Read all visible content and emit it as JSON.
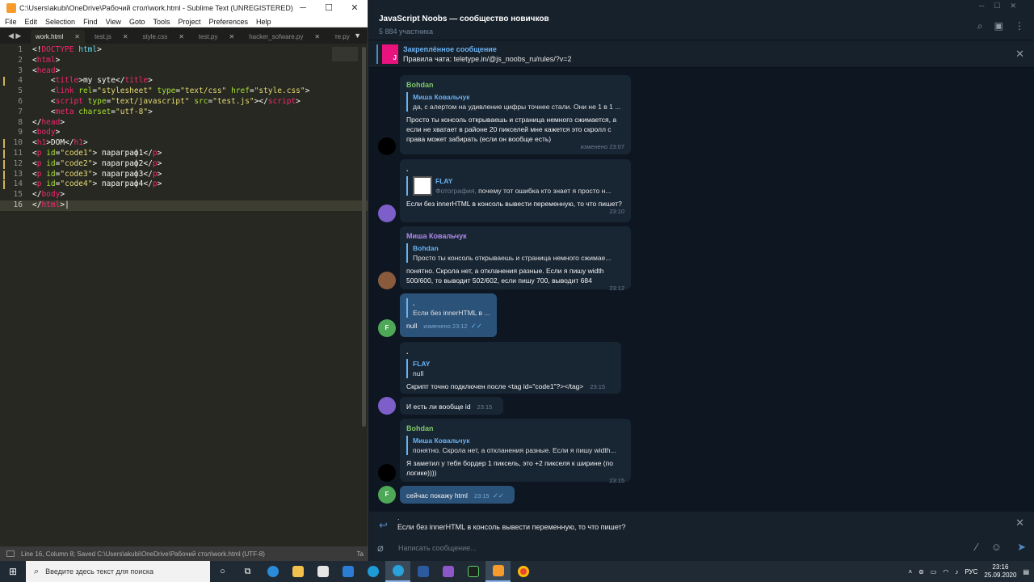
{
  "sublime": {
    "title": "C:\\Users\\akubi\\OneDrive\\Рабочий стол\\work.html - Sublime Text (UNREGISTERED)",
    "menu": [
      "File",
      "Edit",
      "Selection",
      "Find",
      "View",
      "Goto",
      "Tools",
      "Project",
      "Preferences",
      "Help"
    ],
    "tabs": [
      "work.html",
      "test.js",
      "style.css",
      "test.py",
      "hacker_sofware.py",
      "те.py"
    ],
    "lines": [
      {
        "n": "1"
      },
      {
        "n": "2"
      },
      {
        "n": "3"
      },
      {
        "n": "4"
      },
      {
        "n": "5"
      },
      {
        "n": "6"
      },
      {
        "n": "7"
      },
      {
        "n": "8"
      },
      {
        "n": "9"
      },
      {
        "n": "10"
      },
      {
        "n": "11"
      },
      {
        "n": "12"
      },
      {
        "n": "13"
      },
      {
        "n": "14"
      },
      {
        "n": "15"
      },
      {
        "n": "16"
      }
    ],
    "code": {
      "l1a": "<!",
      "l1b": "DOCTYPE",
      "l1c": " html",
      "l1d": ">",
      "l2": "html",
      "l3": "head",
      "l4tag": "title",
      "l4text": "my syte",
      "l5tag": "link",
      "l5a1": "rel",
      "l5v1": "\"stylesheet\"",
      "l5a2": "type",
      "l5v2": "\"text/css\"",
      "l5a3": "href",
      "l5v3": "\"style.css\"",
      "l6tag": "script",
      "l6a1": "type",
      "l6v1": "\"text/javascript\"",
      "l6a2": "src",
      "l6v2": "\"test.js\"",
      "l7tag": "meta",
      "l7a1": "charset",
      "l7v1": "\"utf-8\"",
      "l8": "head",
      "l9": "body",
      "l10tag": "h1",
      "l10text": "DOM",
      "ptag": "p",
      "pattr": "id",
      "p1id": "\"code1\"",
      "p1text": " параграф1",
      "p2id": "\"code2\"",
      "p2text": " параграф2",
      "p3id": "\"code3\"",
      "p3text": " параграф3",
      "p4id": "\"code4\"",
      "p4text": " параграф4",
      "l15": "body",
      "l16": "html"
    },
    "status": "Line 16, Column 8; Saved C:\\Users\\akubi\\OneDrive\\Рабочий стол\\work.html (UTF-8)",
    "status_right": "Ta"
  },
  "telegram": {
    "chat_title": "JavaScript Noobs — сообщество новичков",
    "members": "5 884 участника",
    "pinned_title": "Закреплённое сообщение",
    "pinned_text": "Правила чата: teletype.in/@js_noobs_ru/rules/?v=2",
    "pinned_thumb": "J",
    "messages": {
      "m1": {
        "author": "Bohdan",
        "reply_name": "Миша Ковальчук",
        "reply_text": "да, с алертом на удивление цифры точнее стали. Они не 1 в 1 ...",
        "text": "Просто ты консоль открываешь и страница немного сжимается, а если не хватает в районе 20 пикселей мне кажется это скролл с права может забирать (если он вообще есть)",
        "time": "изменено 23:07"
      },
      "m2": {
        "author": ".",
        "reply_name": "FLAY",
        "reply_prefix": "Фотография,",
        "reply_text": " почему тот ошибка кто знает я просто н...",
        "text": "Если без innerHTML в консоль вывести переменную, то что пишет?",
        "time": "23:10"
      },
      "m3": {
        "author": "Миша Ковальчук",
        "reply_name": "Bohdan",
        "reply_text": "Просто ты консоль открываешь и страница немного сжимае...",
        "text": "понятно. Скрола нет, а откланения разные. Если я пишу width 500/600, то выводит 502/602, если пишу 700, выводит 684",
        "time": "23:12"
      },
      "m4": {
        "reply_name": ".",
        "reply_text": "Если без innerHTML в ...",
        "text": "null",
        "time": "изменено 23:12"
      },
      "m5": {
        "author": ".",
        "reply_name": "FLAY",
        "reply_text": "null",
        "text": "Скрипт точно подключен после <tag id=\"code1\"?></tag>",
        "time": "23:15"
      },
      "m6": {
        "text": "И есть ли вообще id",
        "time": "23:15"
      },
      "m7": {
        "author": "Bohdan",
        "reply_name": "Миша Ковальчук",
        "reply_text": "понятно. Скрола нет, а откланения разные. Если я пишу width...",
        "text": "Я заметил у тебя бордер 1 пиксель, это +2 пикселя к ширине (по логике))))",
        "time": "23:15"
      },
      "m8": {
        "text": "сейчас покажу html",
        "time": "23:15"
      }
    },
    "avatar_letter": "F",
    "reply_bar_name": ".",
    "reply_bar_text": "Если без innerHTML в консоль вывести переменную, то что пишет?",
    "input_placeholder": "Написать сообщение..."
  },
  "taskbar": {
    "search_placeholder": "Введите здесь текст для поиска",
    "lang": "РУС",
    "time": "23:16",
    "date": "25.09.2020"
  },
  "colors": {
    "editor_bg": "#272822",
    "telegram_bg": "#0e1621",
    "outgoing_bubble": "#2b5278",
    "incoming_bubble": "#182533",
    "accent": "#6ab2f2"
  }
}
